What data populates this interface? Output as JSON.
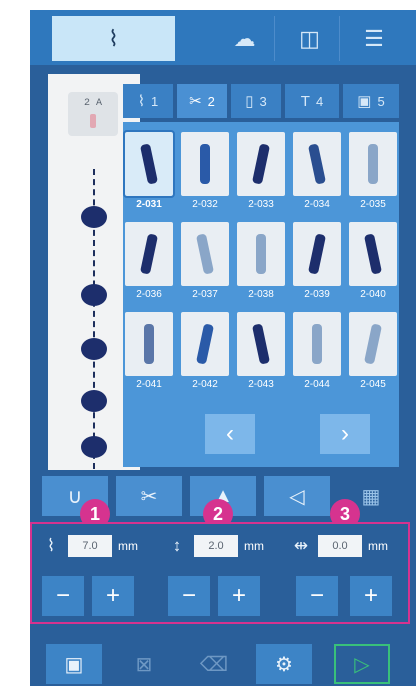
{
  "top_tabs": [
    {
      "icon": "zigzag-icon",
      "glyph": "⌇"
    },
    {
      "icon": "cloud-icon",
      "glyph": "☁"
    },
    {
      "icon": "layers-icon",
      "glyph": "◫"
    },
    {
      "icon": "menu-icon",
      "glyph": "☰"
    }
  ],
  "preview": {
    "foot_label": "2  A"
  },
  "category_tabs": [
    {
      "icon": "zigzag-icon",
      "glyph": "⌇",
      "number": "1"
    },
    {
      "icon": "decorative-stitch-icon",
      "glyph": "✂",
      "number": "2"
    },
    {
      "icon": "buttonhole-icon",
      "glyph": "▯",
      "number": "3"
    },
    {
      "icon": "text-icon",
      "glyph": "T",
      "number": "4"
    },
    {
      "icon": "image-file-icon",
      "glyph": "▣",
      "number": "5"
    }
  ],
  "stitches": [
    {
      "code": "2-031",
      "selected": true,
      "color": "#1d2e6c"
    },
    {
      "code": "2-032",
      "selected": false,
      "color": "#2a5aa8"
    },
    {
      "code": "2-033",
      "selected": false,
      "color": "#1d2e6c"
    },
    {
      "code": "2-034",
      "selected": false,
      "color": "#2a4e90"
    },
    {
      "code": "2-035",
      "selected": false,
      "color": "#8aa6c8"
    },
    {
      "code": "2-036",
      "selected": false,
      "color": "#1d2e6c"
    },
    {
      "code": "2-037",
      "selected": false,
      "color": "#8aa6c8"
    },
    {
      "code": "2-038",
      "selected": false,
      "color": "#8aa6c8"
    },
    {
      "code": "2-039",
      "selected": false,
      "color": "#1d2e6c"
    },
    {
      "code": "2-040",
      "selected": false,
      "color": "#1d2e6c"
    },
    {
      "code": "2-041",
      "selected": false,
      "color": "#5a76a8"
    },
    {
      "code": "2-042",
      "selected": false,
      "color": "#2a5aa8"
    },
    {
      "code": "2-043",
      "selected": false,
      "color": "#1d2e6c"
    },
    {
      "code": "2-044",
      "selected": false,
      "color": "#8aa6c8"
    },
    {
      "code": "2-045",
      "selected": false,
      "color": "#8aa6c8"
    }
  ],
  "nav": {
    "prev": "‹",
    "next": "›"
  },
  "tools": [
    {
      "icon": "needle-icon",
      "glyph": "∪",
      "ghost": false
    },
    {
      "icon": "scissors-icon",
      "glyph": "✂",
      "ghost": false
    },
    {
      "icon": "needle-down-icon",
      "glyph": "▲",
      "ghost": false
    },
    {
      "icon": "presser-foot-icon",
      "glyph": "◁",
      "ghost": false
    },
    {
      "icon": "grid-icon",
      "glyph": "▦",
      "ghost": true
    }
  ],
  "settings": [
    {
      "badge": "1",
      "icon": "stitch-width-icon",
      "glyph": "⌇",
      "value": "7.0",
      "unit": "mm"
    },
    {
      "badge": "2",
      "icon": "stitch-length-icon",
      "glyph": "↕",
      "value": "2.0",
      "unit": "mm"
    },
    {
      "badge": "3",
      "icon": "needle-position-icon",
      "glyph": "⇹",
      "value": "0.0",
      "unit": "mm"
    }
  ],
  "stepper": {
    "minus": "−",
    "plus": "+"
  },
  "bottom": [
    {
      "icon": "save-icon",
      "glyph": "▣",
      "style": "blue"
    },
    {
      "icon": "delete-file-icon",
      "glyph": "⊠",
      "style": "dim"
    },
    {
      "icon": "trash-icon",
      "glyph": "⌫",
      "style": "dim"
    },
    {
      "icon": "settings-gear-icon",
      "glyph": "⚙",
      "style": "blue"
    },
    {
      "icon": "play-icon",
      "glyph": "▷",
      "style": "green"
    }
  ],
  "colors": {
    "accent": "#d6338f",
    "bar": "#2f78bd",
    "grid": "#4c96d8",
    "start": "#39c07a"
  }
}
